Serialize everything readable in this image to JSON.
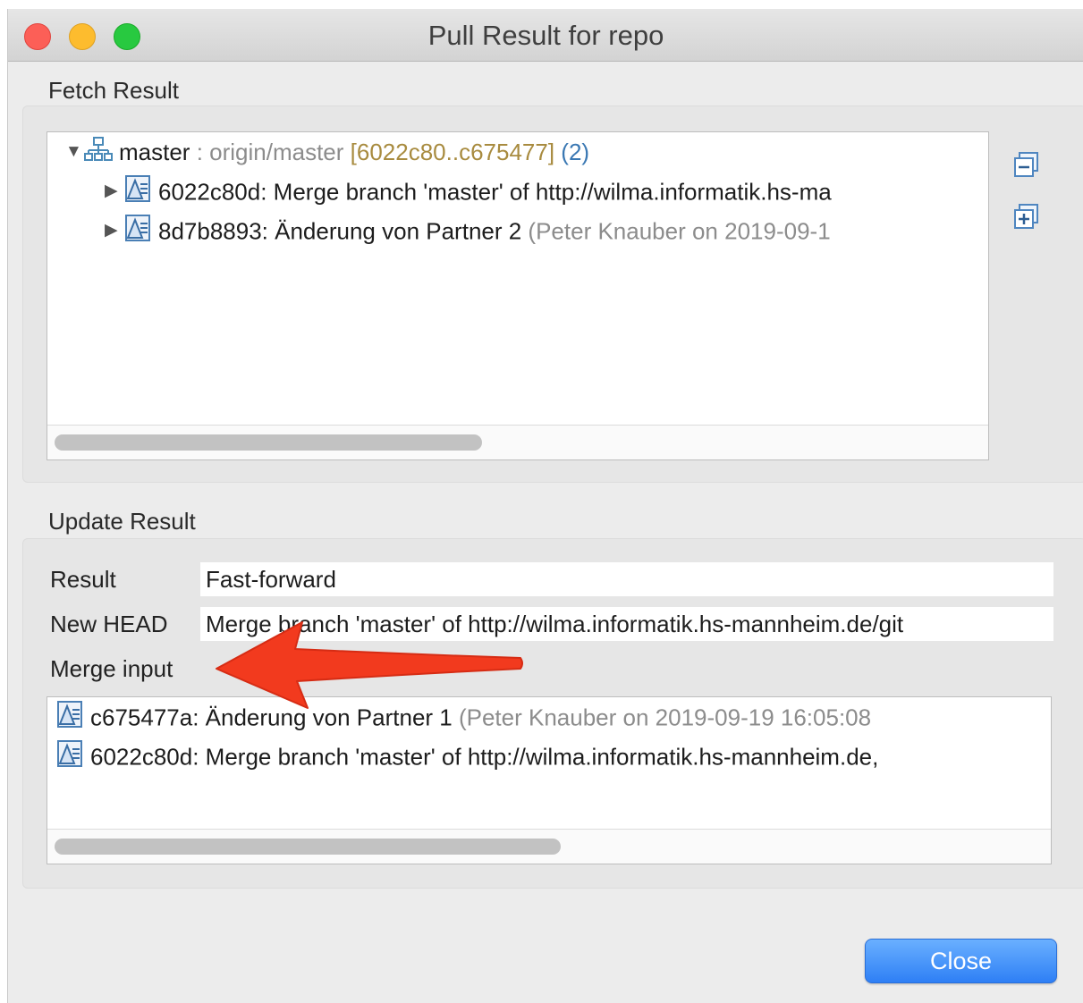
{
  "window": {
    "title": "Pull Result for repo"
  },
  "fetch": {
    "section_label": "Fetch Result",
    "branch": {
      "name": "master",
      "remote": " : origin/master",
      "range": " [6022c80..c675477]",
      "count": " (2)"
    },
    "commits": [
      {
        "text": "6022c80d: Merge branch 'master' of http://wilma.informatik.hs-ma",
        "meta": ""
      },
      {
        "text": "8d7b8893: Änderung von Partner 2",
        "meta": " (Peter Knauber on 2019-09-1"
      }
    ],
    "collapse_icon": "collapse-all-icon",
    "expand_icon": "expand-all-icon"
  },
  "update": {
    "section_label": "Update Result",
    "result_label": "Result",
    "result_value": "Fast-forward",
    "head_label": "New HEAD",
    "head_value": "Merge branch 'master' of http://wilma.informatik.hs-mannheim.de/git",
    "merge_label": "Merge input",
    "merge_items": [
      {
        "text": "c675477a: Änderung von Partner 1",
        "meta": " (Peter Knauber on 2019-09-19 16:05:08"
      },
      {
        "text": "6022c80d: Merge branch 'master' of http://wilma.informatik.hs-mannheim.de,",
        "meta": ""
      }
    ]
  },
  "buttons": {
    "close": "Close"
  },
  "colors": {
    "accent": "#2e7ff5",
    "annotation_arrow": "#f23a1e",
    "range": "#a88b3f",
    "count": "#3a78b3"
  }
}
